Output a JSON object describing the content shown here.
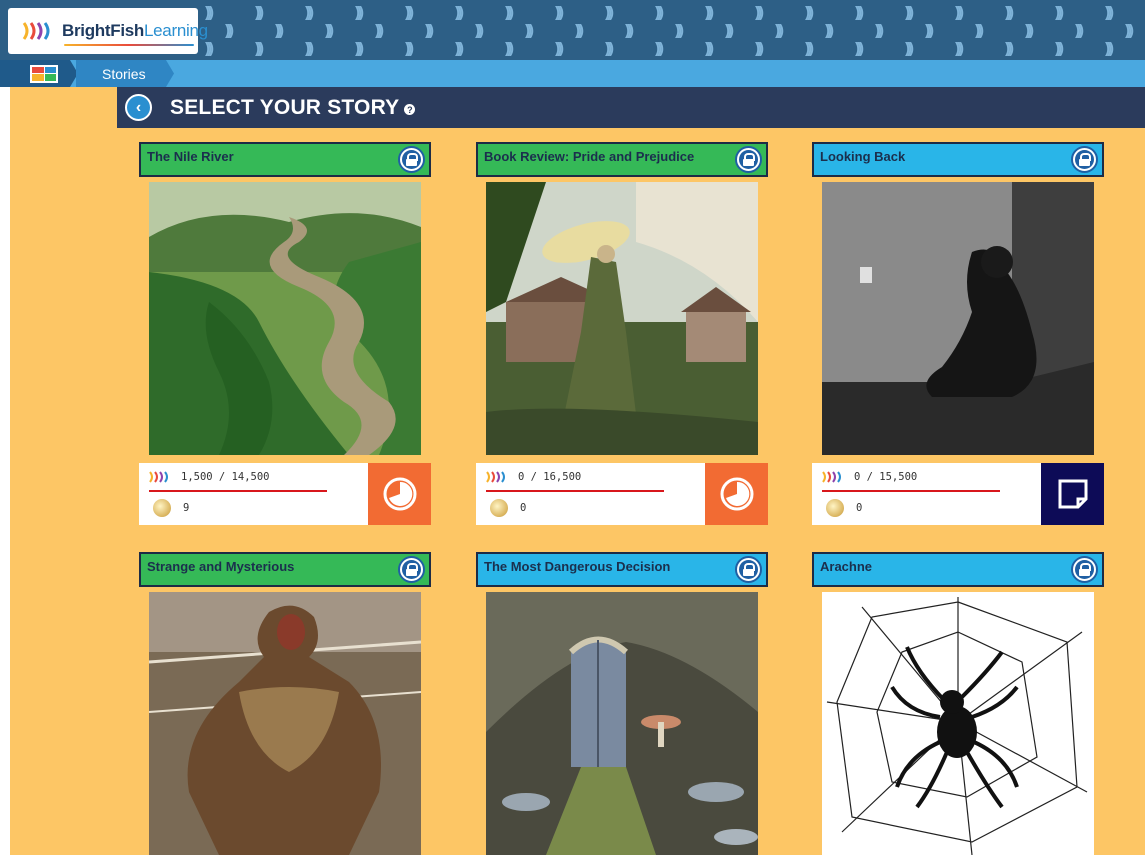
{
  "brand": {
    "name_bold": "BrightFish",
    "name_light": "Learning"
  },
  "breadcrumb": {
    "home_icon": "grid-home-icon",
    "stories_label": "Stories"
  },
  "header": {
    "title": "SELECT YOUR STORY",
    "help_icon": "question-icon",
    "back_icon": "chevron-left-icon"
  },
  "colors": {
    "main_bg": "#fdc665",
    "title_bg": "#2b3b5c",
    "green_head": "#35b957",
    "blue_head": "#29b5e8",
    "orange_status": "#f26b33",
    "navy_status": "#0d0b57"
  },
  "stories": [
    {
      "title": "The Nile River",
      "color": "green",
      "points": "1,500 / 14,500",
      "medals": "9",
      "status_icon": "timer-icon",
      "image": "nile-river-landscape"
    },
    {
      "title": "Book Review: Pride and Prejudice",
      "color": "green",
      "points": "0 / 16,500",
      "medals": "0",
      "status_icon": "timer-icon",
      "image": "woman-with-parasol-painting"
    },
    {
      "title": "Looking Back",
      "color": "blue",
      "points": "0 / 15,500",
      "medals": "0",
      "status_icon": "note-icon",
      "image": "person-sitting-in-corner"
    },
    {
      "title": "Strange and Mysterious",
      "color": "green",
      "image": "creature-monster"
    },
    {
      "title": "The Most Dangerous Decision",
      "color": "blue",
      "image": "fantasy-door-mushrooms"
    },
    {
      "title": "Arachne",
      "color": "blue",
      "image": "spider-web-drawing"
    }
  ]
}
